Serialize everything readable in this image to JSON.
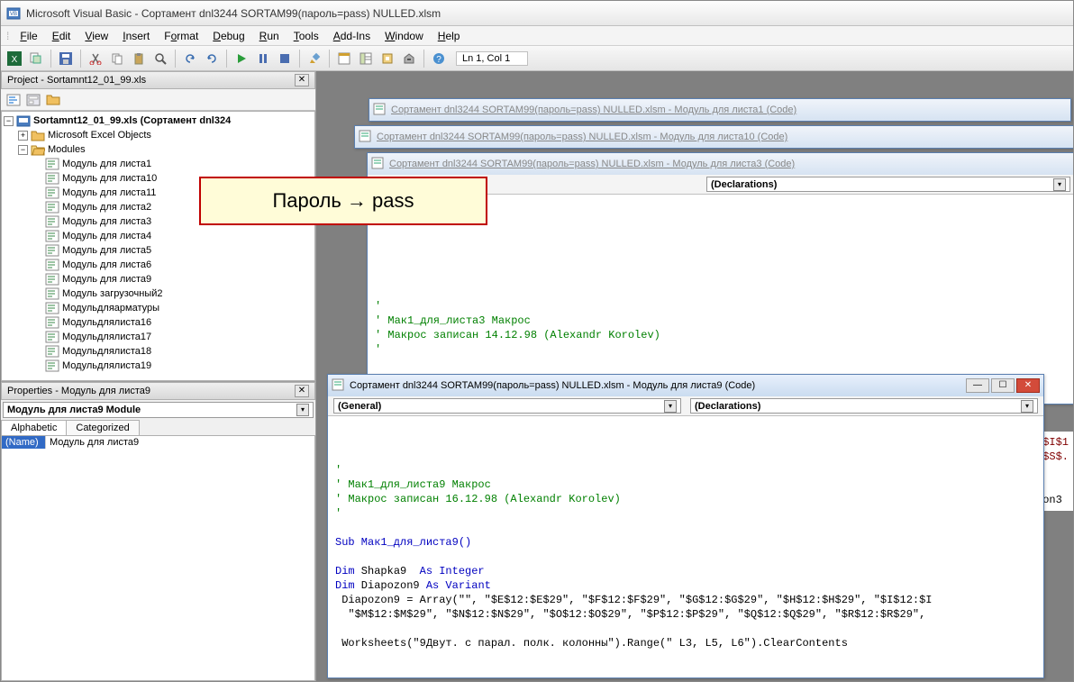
{
  "titlebar": {
    "text": "Microsoft Visual Basic - Сортамент dnl3244 SORTAM99(пароль=pass) NULLED.xlsm"
  },
  "menubar": [
    "File",
    "Edit",
    "View",
    "Insert",
    "Format",
    "Debug",
    "Run",
    "Tools",
    "Add-Ins",
    "Window",
    "Help"
  ],
  "status": "Ln 1, Col 1",
  "project_panel": {
    "title": "Project - Sortamnt12_01_99.xls",
    "root": "Sortamnt12_01_99.xls (Сортамент dnl324",
    "group_objects": "Microsoft Excel Objects",
    "group_modules": "Modules",
    "modules": [
      "Модуль для листа1",
      "Модуль для листа10",
      "Модуль для листа11",
      "Модуль для листа2",
      "Модуль для листа3",
      "Модуль для листа4",
      "Модуль для листа5",
      "Модуль для листа6",
      "Модуль для листа9",
      "Модуль загрузочный2",
      "Модульдляарматуры",
      "Модульдлялиста16",
      "Модульдлялиста17",
      "Модульдлялиста18",
      "Модульдлялиста19"
    ]
  },
  "properties_panel": {
    "title": "Properties - Модуль для листа9",
    "combo": "Модуль для листа9 Module",
    "tabs": [
      "Alphabetic",
      "Categorized"
    ],
    "prop_name": "(Name)",
    "prop_val": "Модуль для листа9"
  },
  "callout": "Пароль → pass",
  "code_windows": {
    "bg1_title": "Сортамент dnl3244 SORTAM99(пароль=pass) NULLED.xlsm - Модуль для листа1 (Code)",
    "bg2_title": "Сортамент dnl3244 SORTAM99(пароль=pass) NULLED.xlsm - Модуль для листа10 (Code)",
    "bg3_title": "Сортамент dnl3244 SORTAM99(пароль=pass) NULLED.xlsm - Модуль для листа3 (Code)",
    "bg3_decl": "(Declarations)",
    "bg3_comment1": "' Мак1_для_листа3 Макрос",
    "bg3_comment2": "' Макрос записан 14.12.98 (Alexandr Korolev)",
    "active_title": "Сортамент dnl3244 SORTAM99(пароль=pass) NULLED.xlsm - Модуль для листа9 (Code)",
    "combo_left": "(General)",
    "combo_right": "(Declarations)",
    "c9_cm1": "' Мак1_для_листа9 Макрос",
    "c9_cm2": "' Макрос записан 16.12.98 (Alexandr Korolev)",
    "c9_sub": "Sub Мак1_для_листа9()",
    "c9_dim1a": "Dim",
    "c9_dim1b": " Shapka9  ",
    "c9_dim1c": "As Integer",
    "c9_dim2a": "Dim",
    "c9_dim2b": " Diapozon9 ",
    "c9_dim2c": "As Variant",
    "c9_arr": " Diapozon9 = Array(\"\", \"$E$12:$E$29\", \"$F$12:$F$29\", \"$G$12:$G$29\", \"$H$12:$H$29\", \"$I$12:$I",
    "c9_arr2": "  \"$M$12:$M$29\", \"$N$12:$N$29\", \"$O$12:$O$29\", \"$P$12:$P$29\", \"$Q$12:$Q$29\", \"$R$12:$R$29\",",
    "c9_ws": " Worksheets(\"9Двут. с парал. полк. колонны\").Range(\" L3, L5, L6\").ClearContents",
    "rfrag1": "\"$I$1",
    "rfrag2": "\"$S$.",
    "rfrag3": "zon3"
  }
}
